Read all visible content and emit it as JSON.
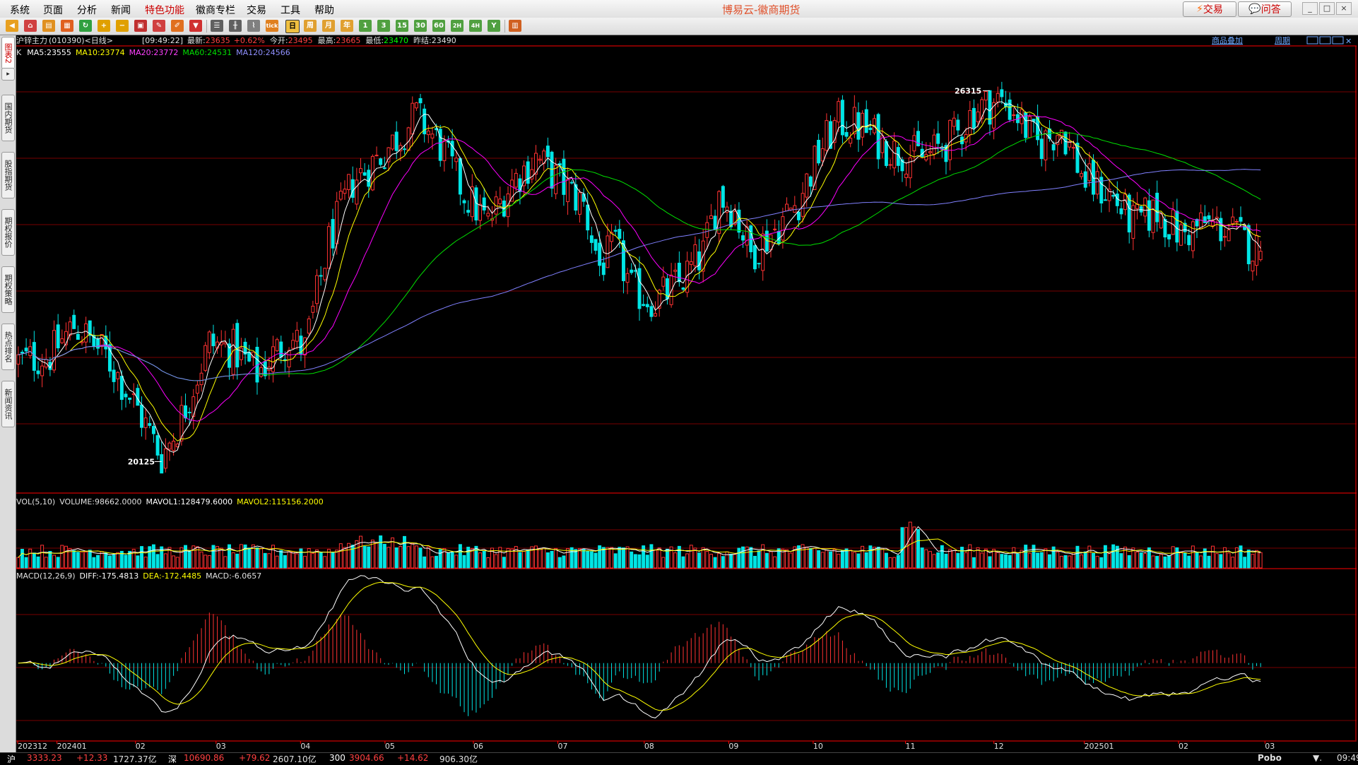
{
  "app": {
    "title": "博易云-徽商期货",
    "trade_button": "交易",
    "help_button": "问答"
  },
  "menu": [
    "系统",
    "页面",
    "分析",
    "新闻",
    "特色功能",
    "徽商专栏",
    "交易",
    "工具",
    "帮助"
  ],
  "toolbar": {
    "period_buttons": [
      "日",
      "周",
      "月",
      "年",
      "1",
      "3",
      "15",
      "30",
      "60",
      "2H",
      "4H",
      "Y"
    ]
  },
  "sidebar": {
    "tabs": [
      "图表2",
      "国内期货",
      "股指期货",
      "期权报价",
      "期权策略",
      "热点排名",
      "新闻资讯"
    ]
  },
  "header": {
    "symbol": "沪锌主力",
    "code": "(010390)",
    "period": "<日线>",
    "time": "[09:49:22]",
    "last_label": "最新:",
    "last": "23635",
    "change_pct": "+0.62%",
    "open_label": "今开:",
    "open": "23495",
    "high_label": "最高:",
    "high": "23665",
    "low_label": "最低:",
    "low": "23470",
    "prev_settle_label": "昨结:",
    "prev_settle": "23490",
    "overlay_link": "商品叠加",
    "cycle_link": "周期"
  },
  "ma_legend": {
    "prefix": "K",
    "ma5": "MA5:23555",
    "ma10": "MA10:23774",
    "ma20": "MA20:23772",
    "ma60": "MA60:24531",
    "ma120": "MA120:24566"
  },
  "vol_legend": {
    "name": "VOL(5,10)",
    "volume": "VOLUME:98662.0000",
    "mavol1": "MAVOL1:128479.6000",
    "mavol2": "MAVOL2:115156.2000"
  },
  "macd_legend": {
    "name": "MACD(12,26,9)",
    "diff": "DIFF:-175.4813",
    "dea": "DEA:-172.4485",
    "macd": "MACD:-6.0657"
  },
  "annotations": {
    "high": "26315",
    "low": "20125"
  },
  "x_axis_labels": [
    "202312",
    "202401",
    "02",
    "03",
    "04",
    "05",
    "06",
    "07",
    "08",
    "09",
    "10",
    "11",
    "12",
    "202501",
    "02",
    "03"
  ],
  "colors": {
    "up": "#ff3232",
    "down": "#00e5e5",
    "ma5": "#ffffff",
    "ma10": "#ffff00",
    "ma20": "#ff00ff",
    "ma60": "#00e000",
    "ma120": "#8080ff",
    "grid": "#780000"
  },
  "chart_data": {
    "type": "candlestick",
    "price_keypoints": [
      [
        0,
        21800
      ],
      [
        8,
        21900
      ],
      [
        14,
        22400
      ],
      [
        22,
        21900
      ],
      [
        30,
        21000
      ],
      [
        36,
        20200
      ],
      [
        40,
        20700
      ],
      [
        48,
        22100
      ],
      [
        54,
        22000
      ],
      [
        60,
        21600
      ],
      [
        68,
        22200
      ],
      [
        72,
        22000
      ],
      [
        78,
        23800
      ],
      [
        84,
        24800
      ],
      [
        92,
        25300
      ],
      [
        100,
        25900
      ],
      [
        106,
        25400
      ],
      [
        112,
        24600
      ],
      [
        118,
        24100
      ],
      [
        124,
        24800
      ],
      [
        130,
        25200
      ],
      [
        136,
        24800
      ],
      [
        142,
        24400
      ],
      [
        146,
        23400
      ],
      [
        150,
        23700
      ],
      [
        154,
        23000
      ],
      [
        160,
        22800
      ],
      [
        166,
        23100
      ],
      [
        172,
        23600
      ],
      [
        176,
        24600
      ],
      [
        180,
        24300
      ],
      [
        184,
        23600
      ],
      [
        190,
        24000
      ],
      [
        196,
        24500
      ],
      [
        202,
        25400
      ],
      [
        206,
        25800
      ],
      [
        212,
        25700
      ],
      [
        220,
        25300
      ],
      [
        228,
        25200
      ],
      [
        236,
        25600
      ],
      [
        240,
        26000
      ],
      [
        246,
        26150
      ],
      [
        250,
        26000
      ],
      [
        256,
        25400
      ],
      [
        262,
        25700
      ],
      [
        268,
        24800
      ],
      [
        274,
        24600
      ],
      [
        280,
        24100
      ],
      [
        286,
        24300
      ],
      [
        292,
        23900
      ],
      [
        298,
        24100
      ],
      [
        304,
        24000
      ],
      [
        310,
        23700
      ],
      [
        312,
        23635
      ]
    ],
    "n_bars": 313,
    "ylim": [
      19600,
      26850
    ],
    "marked_high": 26315,
    "marked_low": 20125,
    "vol_ylim": [
      0,
      400000
    ],
    "macd_ylim": [
      -700,
      850
    ]
  }
}
